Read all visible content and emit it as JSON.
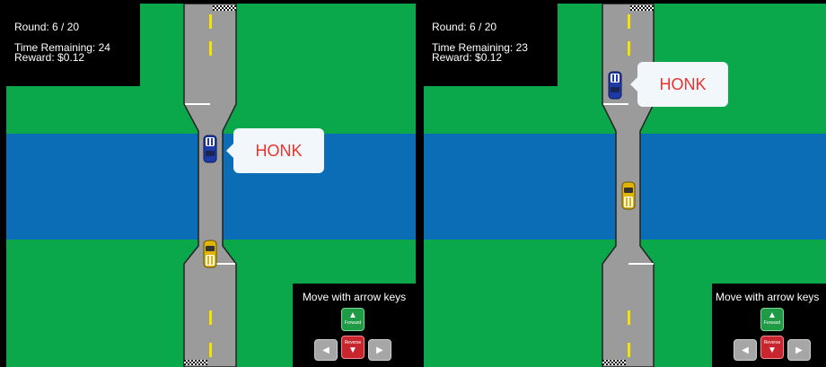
{
  "hud": {
    "round_text": "Round: 6 / 20",
    "reward_text": "Reward: $0.12"
  },
  "panels": [
    {
      "time_text": "Time Remaining: 24",
      "honk_text": "HONK"
    },
    {
      "time_text": "Time Remaining: 23",
      "honk_text": "HONK"
    }
  ],
  "controls": {
    "hint": "Move with arrow keys",
    "forward_label": "Forward",
    "reverse_label": "Reverse",
    "up_glyph": "▲",
    "down_glyph": "▼",
    "left_glyph": "◀",
    "right_glyph": "▶"
  },
  "colors": {
    "grass": "#0aa84b",
    "river": "#0a6db5",
    "road": "#9b9b9b",
    "lane_marking": "#f2e300",
    "player_car": "#1e3aa8",
    "other_car": "#e0b400",
    "honk_text": "#e8342c"
  }
}
